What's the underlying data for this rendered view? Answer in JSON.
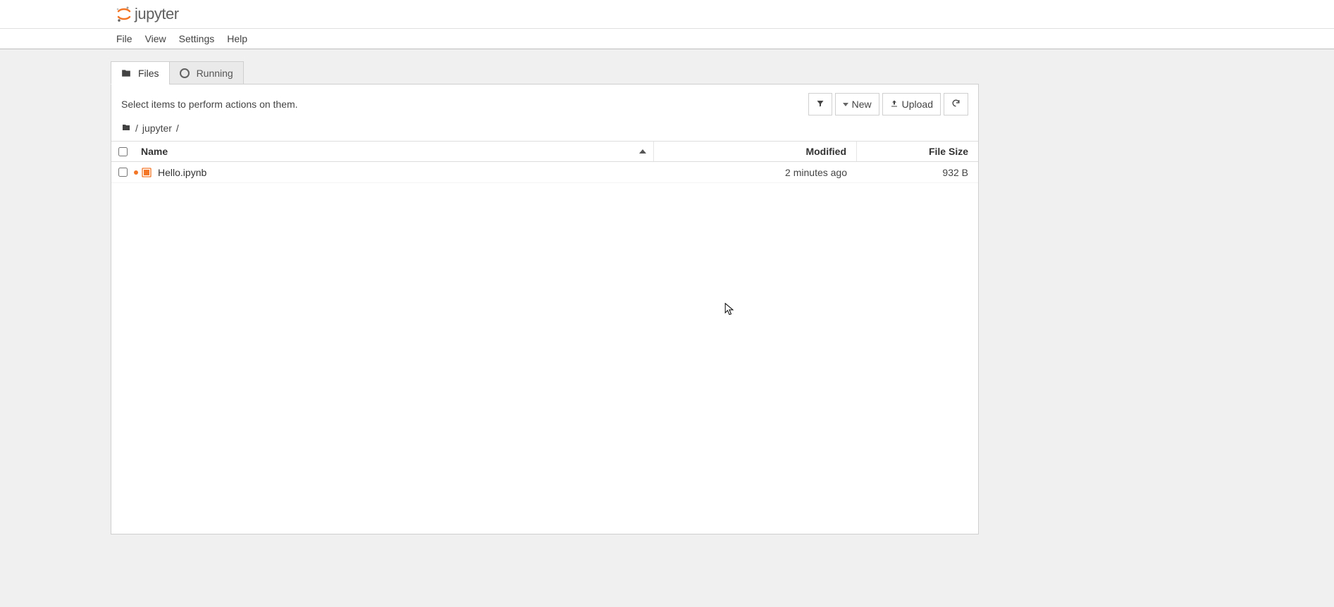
{
  "logo": {
    "text": "jupyter"
  },
  "menu": [
    "File",
    "View",
    "Settings",
    "Help"
  ],
  "tabs": [
    {
      "label": "Files",
      "active": true
    },
    {
      "label": "Running",
      "active": false
    }
  ],
  "hint": "Select items to perform actions on them.",
  "toolbar": {
    "new": "New",
    "upload": "Upload"
  },
  "breadcrumb": {
    "segments": [
      "jupyter"
    ]
  },
  "columns": {
    "name": "Name",
    "modified": "Modified",
    "filesize": "File Size"
  },
  "files": [
    {
      "name": "Hello.ipynb",
      "modified": "2 minutes ago",
      "size": "932 B",
      "running": true
    }
  ]
}
